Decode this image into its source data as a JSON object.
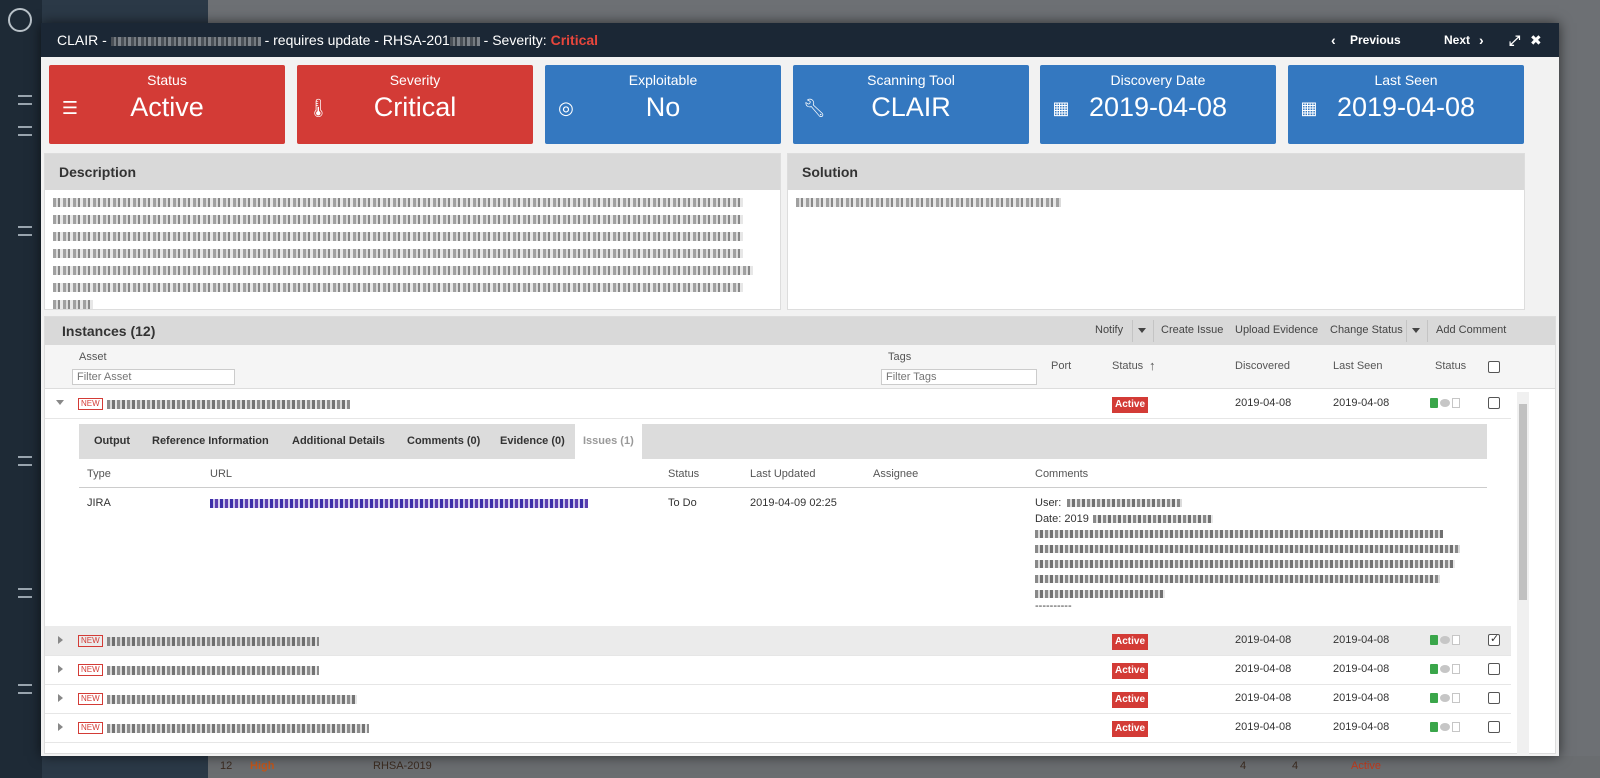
{
  "modal": {
    "title_prefix": "CLAIR - ",
    "title_middle": " - requires update - RHSA-201",
    "title_severity_label": " - Severity: ",
    "title_severity": "Critical",
    "previous": "Previous",
    "next": "Next"
  },
  "tiles": [
    {
      "label": "Status",
      "value": "Active",
      "icon": "list-icon",
      "color": "#d33b36"
    },
    {
      "label": "Severity",
      "value": "Critical",
      "icon": "thermometer-icon",
      "color": "#d33b36"
    },
    {
      "label": "Exploitable",
      "value": "No",
      "icon": "target-icon",
      "color": "#3478c0"
    },
    {
      "label": "Scanning Tool",
      "value": "CLAIR",
      "icon": "wrench-icon",
      "color": "#3478c0"
    },
    {
      "label": "Discovery Date",
      "value": "2019-04-08",
      "icon": "calendar-icon",
      "color": "#3478c0"
    },
    {
      "label": "Last Seen",
      "value": "2019-04-08",
      "icon": "calendar-icon",
      "color": "#3478c0"
    }
  ],
  "description": {
    "title": "Description"
  },
  "solution": {
    "title": "Solution"
  },
  "instances": {
    "title": "Instances (12)",
    "actions": {
      "notify": "Notify",
      "create_issue": "Create Issue",
      "upload_evidence": "Upload Evidence",
      "change_status": "Change Status",
      "add_comment": "Add Comment"
    },
    "columns": {
      "asset": "Asset",
      "tags": "Tags",
      "port": "Port",
      "status": "Status",
      "discovered": "Discovered",
      "last_seen": "Last Seen",
      "status2": "Status"
    },
    "filter_asset_placeholder": "Filter Asset",
    "filter_tags_placeholder": "Filter Tags",
    "rows": [
      {
        "badge": "NEW",
        "status": "Active",
        "discovered": "2019-04-08",
        "last_seen": "2019-04-08",
        "checked": false
      },
      {
        "badge": "NEW",
        "status": "Active",
        "discovered": "2019-04-08",
        "last_seen": "2019-04-08",
        "checked": true
      },
      {
        "badge": "NEW",
        "status": "Active",
        "discovered": "2019-04-08",
        "last_seen": "2019-04-08",
        "checked": false
      },
      {
        "badge": "NEW",
        "status": "Active",
        "discovered": "2019-04-08",
        "last_seen": "2019-04-08",
        "checked": false
      },
      {
        "badge": "NEW",
        "status": "Active",
        "discovered": "2019-04-08",
        "last_seen": "2019-04-08",
        "checked": false
      }
    ],
    "detail": {
      "tabs": [
        "Output",
        "Reference Information",
        "Additional Details",
        "Comments (0)",
        "Evidence (0)",
        "Issues (1)"
      ],
      "active_tab": "Issues (1)",
      "columns": {
        "type": "Type",
        "url": "URL",
        "status": "Status",
        "last_updated": "Last Updated",
        "assignee": "Assignee",
        "comments": "Comments"
      },
      "issue": {
        "type": "JIRA",
        "status": "To Do",
        "last_updated": "2019-04-09 02:25",
        "comment_user_label": "User: ",
        "comment_date_label": "Date: 2019",
        "comment_separator": "----------"
      }
    }
  },
  "background": {
    "bottom_row_num": "12",
    "bottom_row_sev": "High",
    "bottom_row_rhsa": "RHSA-2019",
    "bottom_row_a": "4",
    "bottom_row_b": "4",
    "bottom_row_status": "Active"
  }
}
